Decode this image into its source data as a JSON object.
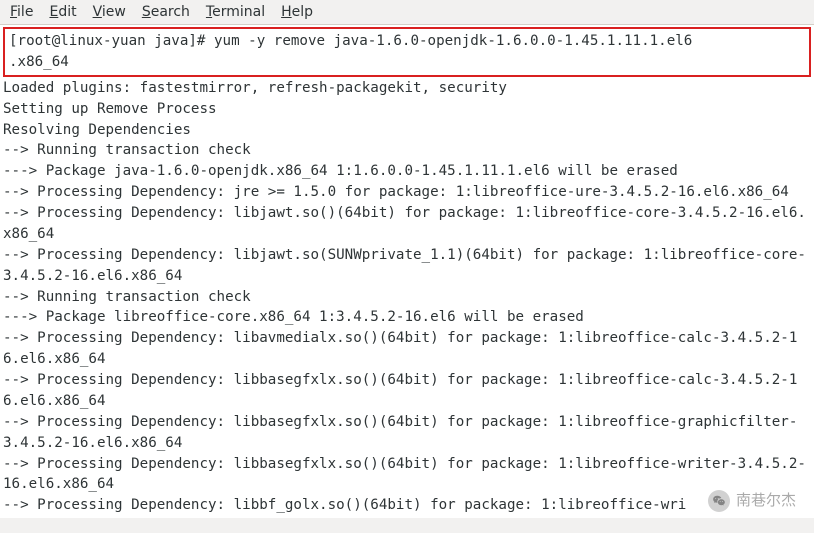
{
  "menu": {
    "file": "File",
    "edit": "Edit",
    "view": "View",
    "search": "Search",
    "terminal": "Terminal",
    "help": "Help"
  },
  "terminal": {
    "command_line1": "[root@linux-yuan java]# yum -y remove java-1.6.0-openjdk-1.6.0.0-1.45.1.11.1.el6",
    "command_line2": ".x86_64",
    "lines": [
      "Loaded plugins: fastestmirror, refresh-packagekit, security",
      "Setting up Remove Process",
      "Resolving Dependencies",
      "--> Running transaction check",
      "---> Package java-1.6.0-openjdk.x86_64 1:1.6.0.0-1.45.1.11.1.el6 will be erased",
      "--> Processing Dependency: jre >= 1.5.0 for package: 1:libreoffice-ure-3.4.5.2-16.el6.x86_64",
      "--> Processing Dependency: libjawt.so()(64bit) for package: 1:libreoffice-core-3.4.5.2-16.el6.x86_64",
      "--> Processing Dependency: libjawt.so(SUNWprivate_1.1)(64bit) for package: 1:libreoffice-core-3.4.5.2-16.el6.x86_64",
      "--> Running transaction check",
      "---> Package libreoffice-core.x86_64 1:3.4.5.2-16.el6 will be erased",
      "--> Processing Dependency: libavmedialx.so()(64bit) for package: 1:libreoffice-calc-3.4.5.2-16.el6.x86_64",
      "--> Processing Dependency: libbasegfxlx.so()(64bit) for package: 1:libreoffice-calc-3.4.5.2-16.el6.x86_64",
      "--> Processing Dependency: libbasegfxlx.so()(64bit) for package: 1:libreoffice-graphicfilter-3.4.5.2-16.el6.x86_64",
      "--> Processing Dependency: libbasegfxlx.so()(64bit) for package: 1:libreoffice-writer-3.4.5.2-16.el6.x86_64",
      "--> Processing Dependency: libbf_golx.so()(64bit) for package: 1:libreoffice-wri"
    ]
  },
  "watermark": {
    "text": "南巷尔杰"
  }
}
